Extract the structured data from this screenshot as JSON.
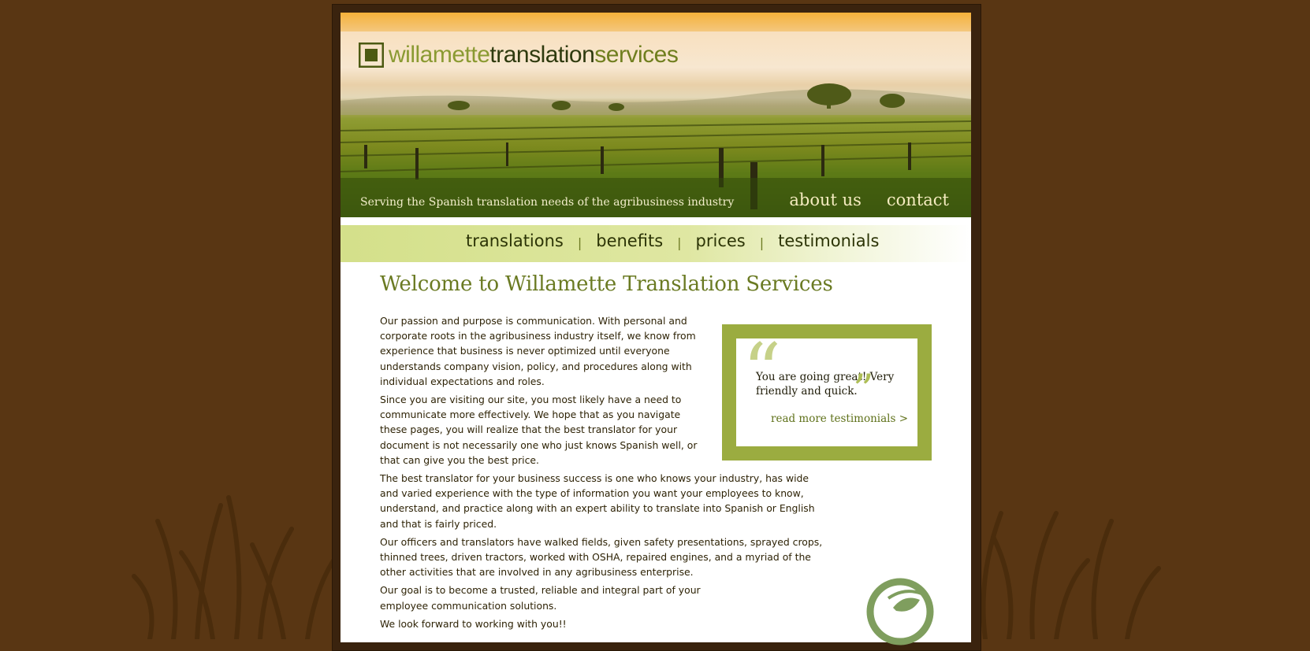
{
  "header": {
    "logo": {
      "part1": "willamette",
      "part2": "translation",
      "part3": "services"
    },
    "tagline": "Serving the Spanish translation needs of the agribusiness industry",
    "top_nav": [
      {
        "label": "about us"
      },
      {
        "label": "contact"
      }
    ]
  },
  "main_nav": {
    "items": [
      {
        "label": "translations"
      },
      {
        "label": "benefits"
      },
      {
        "label": "prices"
      },
      {
        "label": "testimonials"
      }
    ],
    "separator": "|"
  },
  "content": {
    "title": "Welcome to Willamette Translation Services",
    "paragraphs": [
      "Our passion and purpose is communication. With personal and corporate roots in the agribusiness industry itself, we know from experience that business is never optimized until everyone understands company vision, policy, and procedures along with individual expectations and roles.",
      "Since you are visiting our site, you most likely have a need to communicate more effectively. We hope that as you navigate these pages, you will realize that the best translator for your document is not necessarily one who just knows Spanish well, or that can give you the best price.",
      "The best translator for your business success is one who knows your industry, has wide and varied experience with the type of information you want your employees to know, understand, and practice along with an expert ability to translate into Spanish or English and that is fairly priced.",
      "Our officers and translators have walked fields, given safety presentations, sprayed crops, thinned trees, driven tractors, worked with OSHA, repaired engines, and a myriad of the other activities that are involved in any agribusiness enterprise.",
      "Our goal is to become a trusted, reliable and integral part of your employee communication solutions.",
      "We look forward to working with you!!"
    ]
  },
  "testimonial": {
    "quote": "You are going great! Very friendly and quick.",
    "open_mark": "“",
    "close_mark": "”",
    "link": "read more testimonials >"
  },
  "colors": {
    "background": "#593613",
    "accent_green": "#9bac40",
    "title_green": "#6a7a22",
    "nav_strip": "#d4e08a",
    "emblem_green": "#7f9e5e"
  },
  "icons": [
    "logo-square-icon",
    "open-quote-icon",
    "close-quote-icon",
    "leaf-emblem-icon",
    "grass-decoration"
  ]
}
